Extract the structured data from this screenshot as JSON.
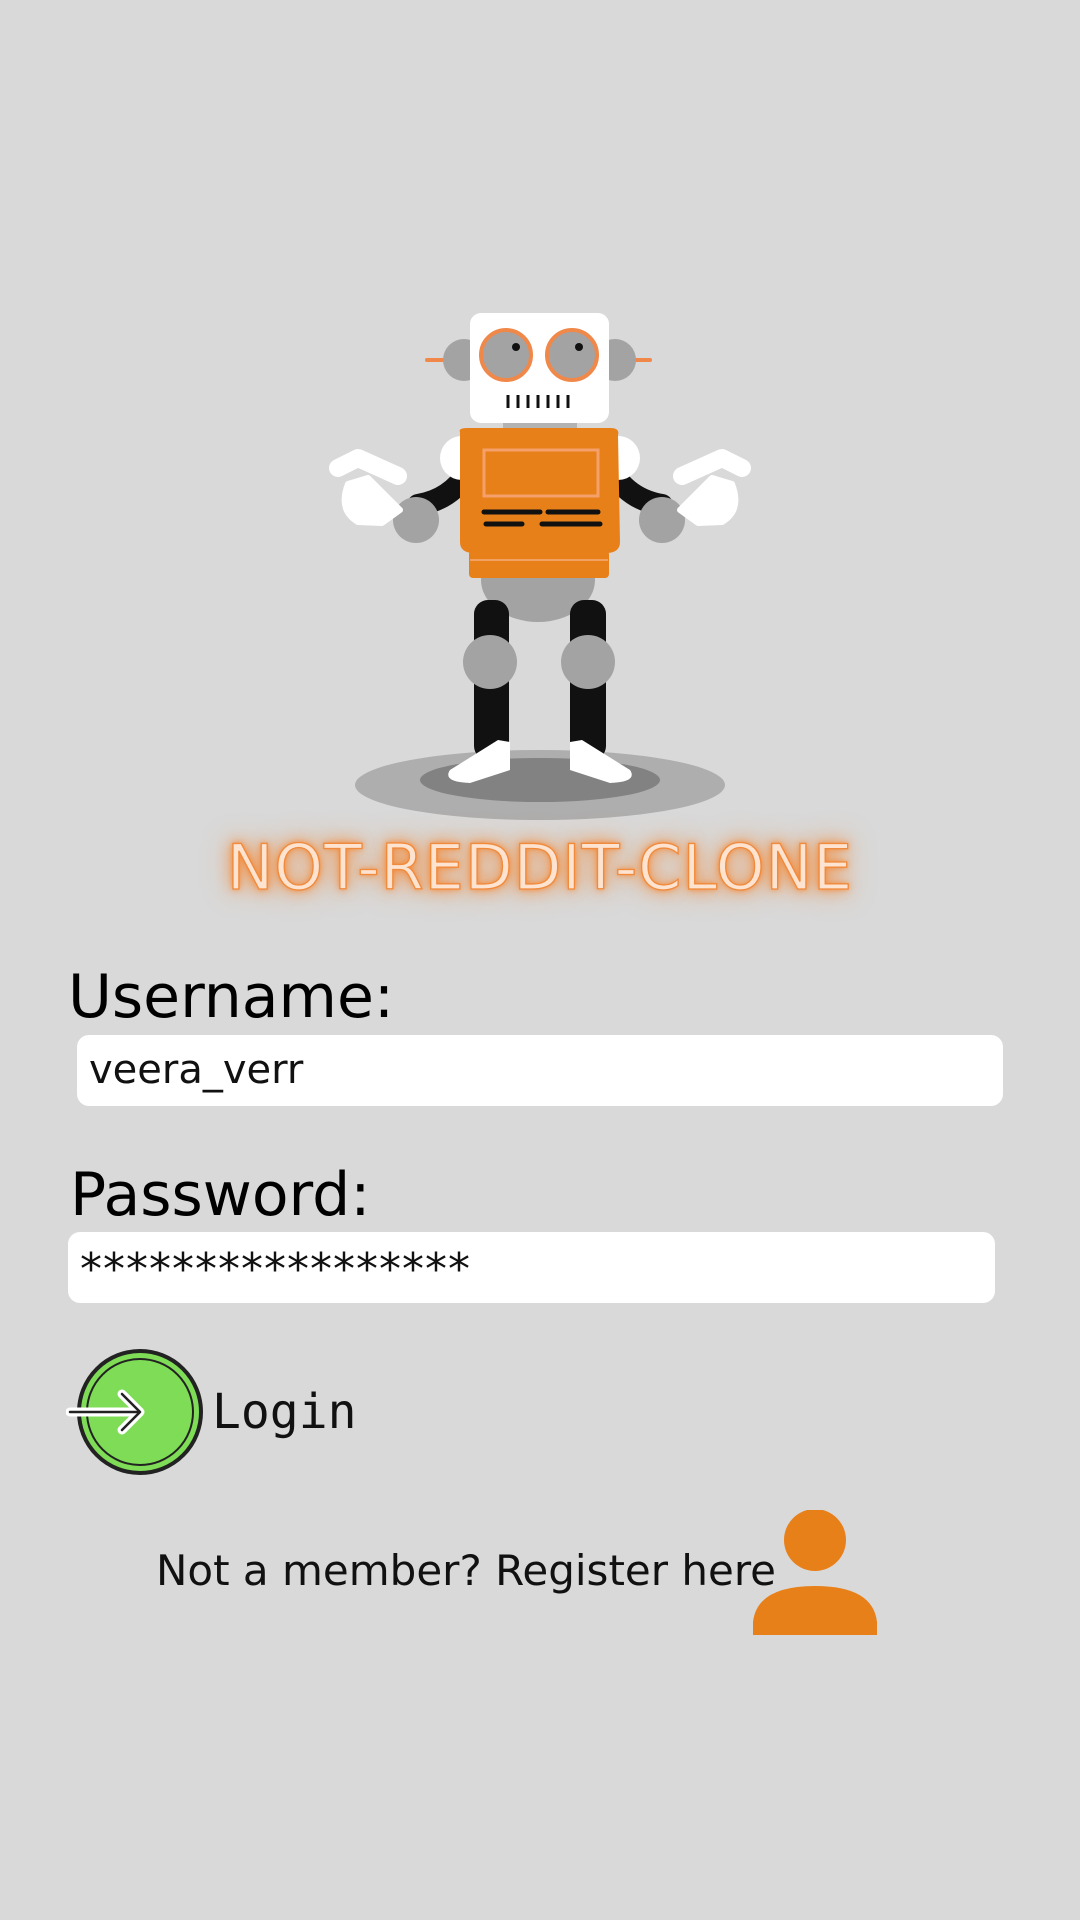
{
  "app": {
    "title": "NOT-REDDIT-CLONE"
  },
  "form": {
    "username_label": "Username:",
    "username_value": "veera_verr",
    "password_label": "Password:",
    "password_value": "*****************"
  },
  "actions": {
    "login_label": "Login",
    "register_text": "Not a member? Register here"
  },
  "icons": {
    "hero": "robot-illustration",
    "login": "login-arrow-icon",
    "register": "user-icon"
  },
  "colors": {
    "background": "#d9d9d9",
    "accent_orange": "#e8801a",
    "login_green": "#7edc56",
    "field_bg": "#ffffff"
  }
}
